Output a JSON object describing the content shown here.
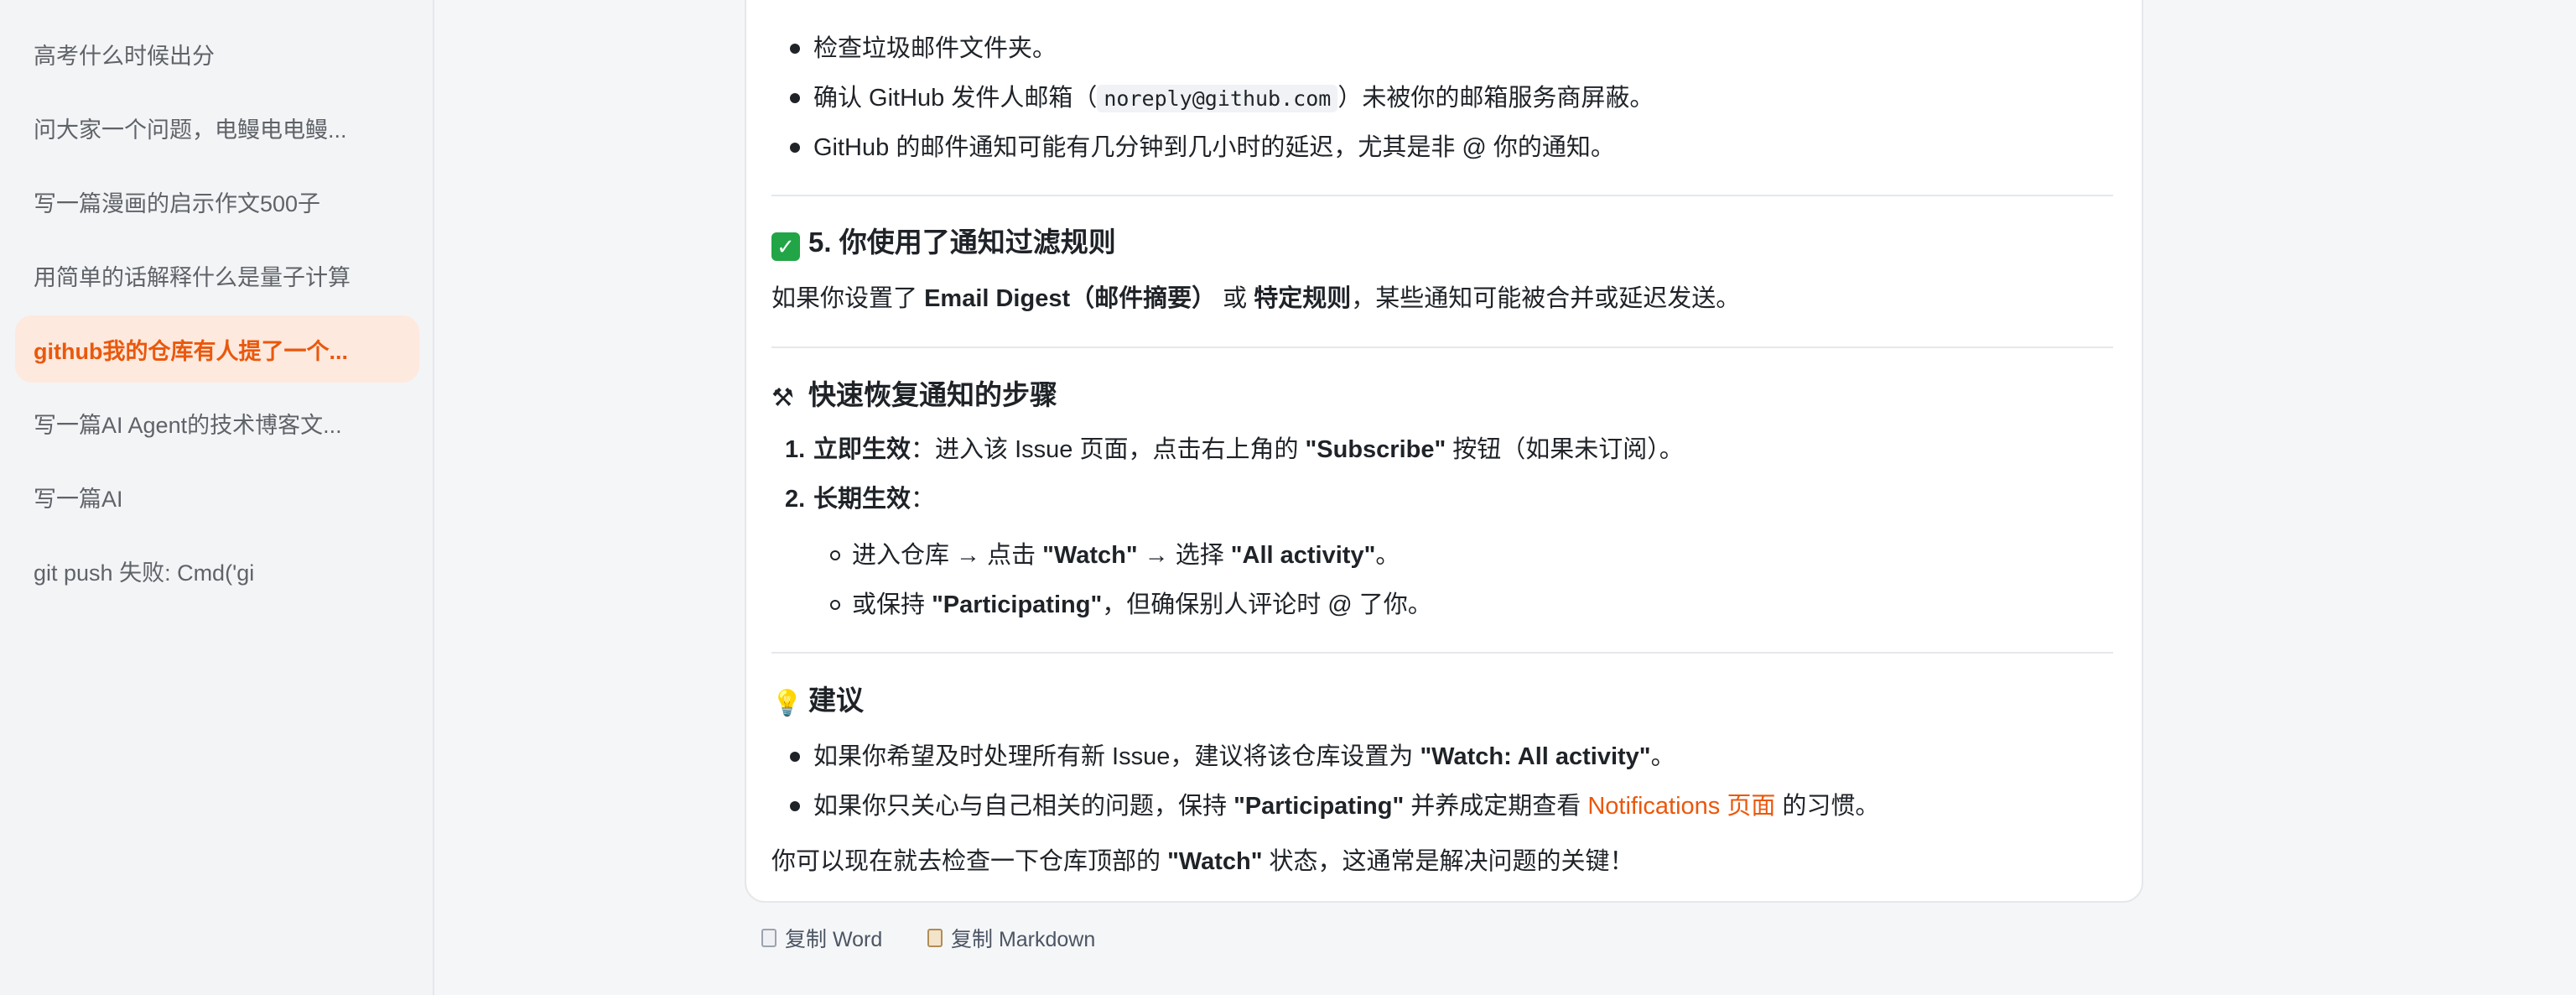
{
  "sidebar": {
    "items": [
      {
        "label": "高考什么时候出分",
        "active": false
      },
      {
        "label": "问大家一个问题，电鳗电电鳗...",
        "active": false
      },
      {
        "label": "写一篇漫画的启示作文500子",
        "active": false
      },
      {
        "label": "用简单的话解释什么是量子计算",
        "active": false
      },
      {
        "label": "github我的仓库有人提了一个...",
        "active": true
      },
      {
        "label": "写一篇AI Agent的技术博客文...",
        "active": false
      },
      {
        "label": "写一篇AI",
        "active": false
      },
      {
        "label": "git push 失败: Cmd('gi",
        "active": false
      }
    ]
  },
  "message": {
    "top_bullets": {
      "b1": "检查垃圾邮件文件夹。",
      "b2_pre": "确认 GitHub 发件人邮箱（",
      "b2_code": "noreply@github.com",
      "b2_post": "）未被你的邮箱服务商屏蔽。",
      "b3": "GitHub 的邮件通知可能有几分钟到几小时的延迟，尤其是非 @ 你的通知。"
    },
    "section5": {
      "title": "5. 你使用了通知过滤规则",
      "para_pre": "如果你设置了 ",
      "para_b1": "Email Digest（邮件摘要）",
      "para_mid": " 或 ",
      "para_b2": "特定规则",
      "para_post": "，某些通知可能被合并或延迟发送。"
    },
    "steps": {
      "title": "快速恢复通知的步骤",
      "s1_num": "1.",
      "s1_b": "立即生效",
      "s1_t1": "：进入该 Issue 页面，点击右上角的 ",
      "s1_b2": "\"Subscribe\"",
      "s1_t2": " 按钮（如果未订阅）。",
      "s2_num": "2.",
      "s2_b": "长期生效",
      "s2_t": "：",
      "sub1_t1": "进入仓库 → 点击 ",
      "sub1_b1": "\"Watch\"",
      "sub1_t2": " → 选择 ",
      "sub1_b2": "\"All activity\"",
      "sub1_t3": "。",
      "sub2_t1": "或保持 ",
      "sub2_b": "\"Participating\"",
      "sub2_t2": "，但确保别人评论时 @ 了你。"
    },
    "advice": {
      "title": "建议",
      "b1_t": "如果你希望及时处理所有新 Issue，建议将该仓库设置为 ",
      "b1_b": "\"Watch: All activity\"",
      "b1_t2": "。",
      "b2_t": "如果你只关心与自己相关的问题，保持 ",
      "b2_b": "\"Participating\"",
      "b2_t2": " 并养成定期查看 ",
      "b2_link": "Notifications 页面",
      "b2_t3": " 的习惯。",
      "final_t1": "你可以现在就去检查一下仓库顶部的 ",
      "final_b": "\"Watch\"",
      "final_t2": " 状态，这通常是解决问题的关键！"
    }
  },
  "actions": {
    "copy_word": "复制 Word",
    "copy_markdown": "复制 Markdown"
  },
  "colors": {
    "accent": "#ea580c",
    "active_bg": "#fde9de",
    "check_green": "#22a546"
  },
  "icons": {
    "section5": "check-mark-icon",
    "steps": "tools-icon",
    "advice": "light-bulb-icon",
    "copy_word": "document-icon",
    "copy_markdown": "clipboard-icon"
  }
}
